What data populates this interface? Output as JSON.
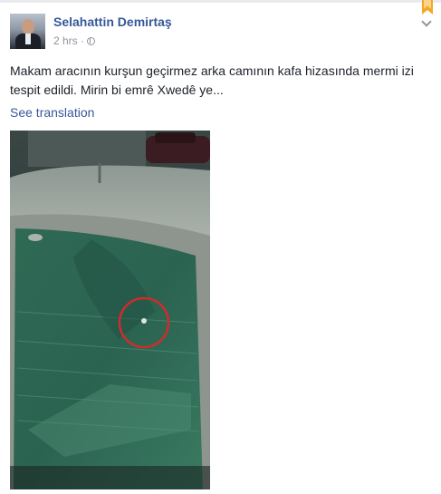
{
  "post": {
    "author": "Selahattin Demirtaş",
    "time": "2 hrs",
    "separator": "·",
    "text": "Makam aracının kurşun geçirmez arka camının kafa hizasında mermi izi tespit edildi. Mirin bi emrê Xwedê ye...",
    "see_translation": "See translation",
    "privacy_icon": "globe-icon",
    "save_icon": "bookmark-icon",
    "menu_icon": "chevron-down-icon"
  },
  "colors": {
    "link": "#365899",
    "text": "#1d2129",
    "meta": "#90949c",
    "bookmark": "#f5a623",
    "marker_circle": "#d12b2b"
  }
}
